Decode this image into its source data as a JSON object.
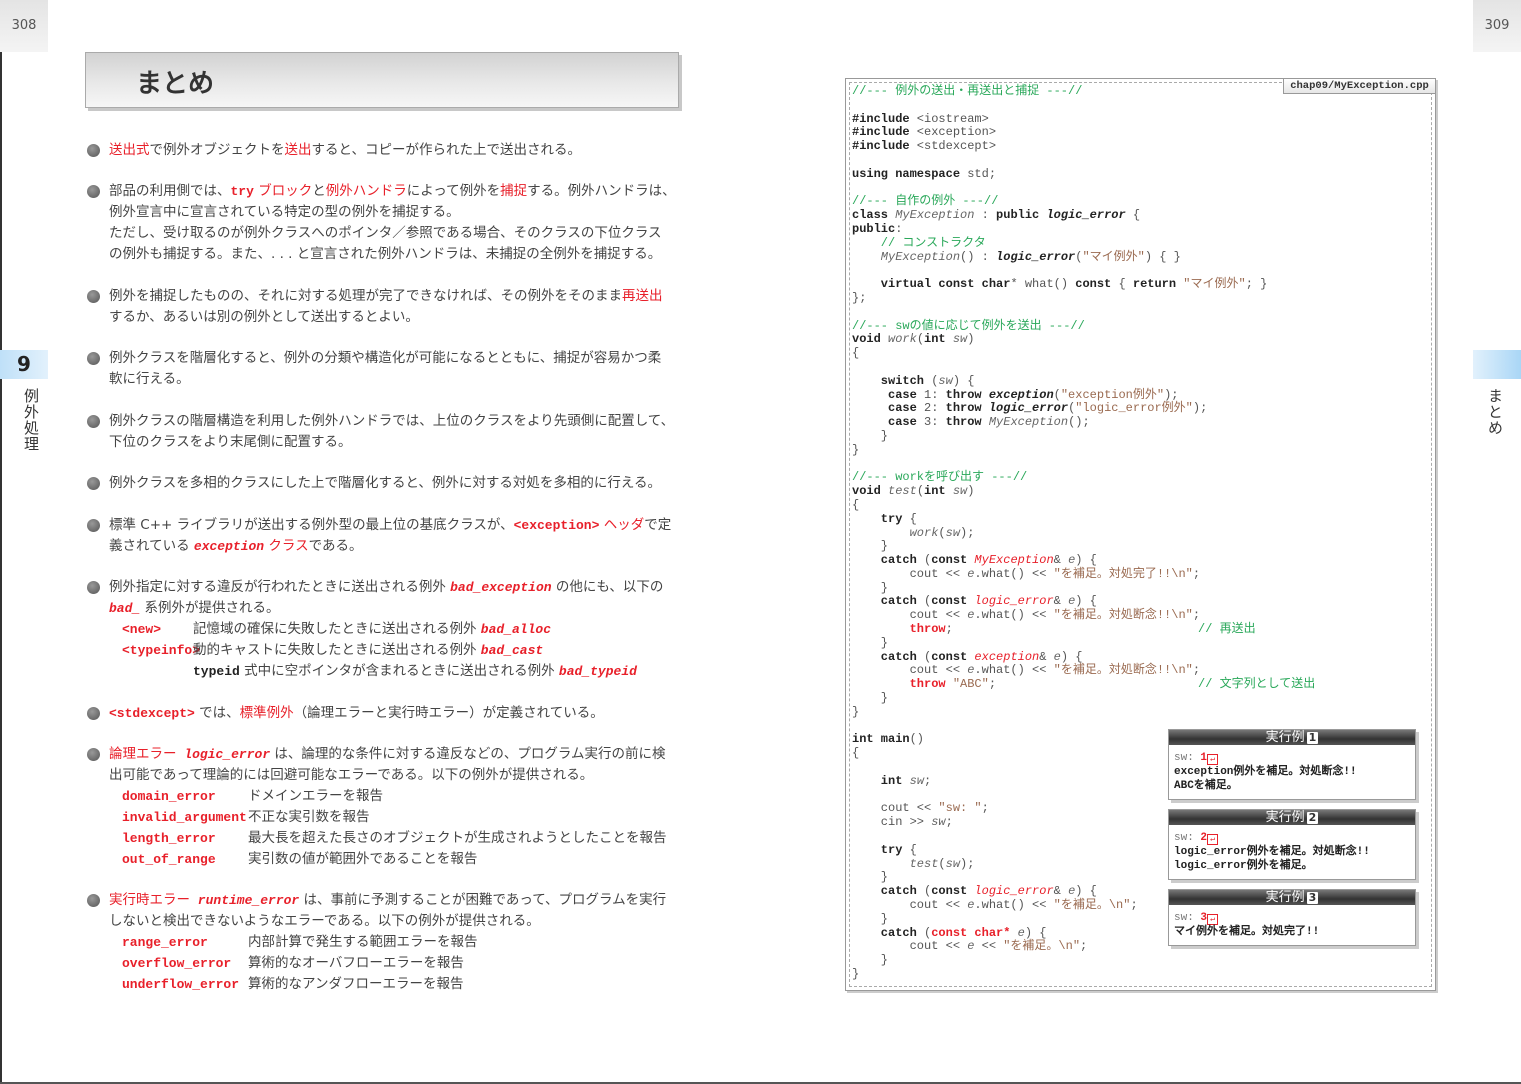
{
  "pages": {
    "left_number": "308",
    "right_number": "309"
  },
  "tabs": {
    "chapter_number": "9",
    "chapter_title": "例外処理",
    "section_title": "まとめ"
  },
  "left": {
    "title": "まとめ",
    "bullets": [
      {
        "lines": [
          [
            [
              "送出式",
              "r"
            ],
            [
              "で例外オブジェクトを",
              ""
            ],
            [
              "送出",
              "r"
            ],
            [
              "すると、コピーが作られた上で送出される。",
              ""
            ]
          ]
        ]
      },
      {
        "lines": [
          [
            [
              "部品の利用側では、",
              ""
            ],
            [
              "try",
              "rc"
            ],
            [
              " ブロック",
              "r"
            ],
            [
              "と",
              ""
            ],
            [
              "例外ハンドラ",
              "r"
            ],
            [
              "によって例外を",
              ""
            ],
            [
              "捕捉",
              "r"
            ],
            [
              "する。例外ハンドラは、",
              ""
            ]
          ],
          [
            [
              "例外宣言中に宣言されている特定の型の例外を捕捉する。",
              ""
            ]
          ],
          [
            [
              "ただし、受け取るのが例外クラスへのポインタ／参照である場合、そのクラスの下位クラス",
              ""
            ]
          ],
          [
            [
              "の例外も捕捉する。また、. . . と宣言された例外ハンドラは、未捕捉の全例外を捕捉する。",
              ""
            ]
          ]
        ]
      },
      {
        "lines": [
          [
            [
              "例外を捕捉したものの、それに対する処理が完了できなければ、その例外をそのまま",
              ""
            ],
            [
              "再送出",
              "r"
            ]
          ],
          [
            [
              "するか、あるいは別の例外として送出するとよい。",
              ""
            ]
          ]
        ]
      },
      {
        "lines": [
          [
            [
              "例外クラスを階層化すると、例外の分類や構造化が可能になるとともに、捕捉が容易かつ柔",
              ""
            ]
          ],
          [
            [
              "軟に行える。",
              ""
            ]
          ]
        ]
      },
      {
        "lines": [
          [
            [
              "例外クラスの階層構造を利用した例外ハンドラでは、上位のクラスをより先頭側に配置して、",
              ""
            ]
          ],
          [
            [
              "下位のクラスをより末尾側に配置する。",
              ""
            ]
          ]
        ]
      },
      {
        "lines": [
          [
            [
              "例外クラスを多相的クラスにした上で階層化すると、例外に対する対処を多相的に行える。",
              ""
            ]
          ]
        ]
      },
      {
        "lines": [
          [
            [
              "標準 C++ ライブラリが送出する例外型の最上位の基底クラスが、",
              ""
            ],
            [
              "<exception>",
              "rc"
            ],
            [
              " ヘッダ",
              "r"
            ],
            [
              "で定",
              ""
            ]
          ],
          [
            [
              "義されている ",
              ""
            ],
            [
              "exception",
              "ri"
            ],
            [
              " クラス",
              "r"
            ],
            [
              "である。",
              ""
            ]
          ]
        ]
      },
      {
        "lines": [
          [
            [
              "例外指定に対する違反が行われたときに送出される例外 ",
              ""
            ],
            [
              "bad_exception",
              "ri"
            ],
            [
              " の他にも、以下の",
              ""
            ]
          ],
          [
            [
              "bad_",
              "ri"
            ],
            [
              " 系例外が提供される。",
              ""
            ]
          ]
        ],
        "sub": [
          {
            "label": "<new>",
            "desc": [
              [
                "記憶域の確保に失敗したときに送出される例外 ",
                ""
              ],
              [
                "bad_alloc",
                "ri"
              ]
            ]
          },
          {
            "label": "<typeinfo>",
            "desc": [
              [
                "動的キャストに失敗したときに送出される例外 ",
                ""
              ],
              [
                "bad_cast",
                "ri"
              ]
            ]
          },
          {
            "label": "",
            "desc": [
              [
                "typeid",
                "c"
              ],
              [
                " 式中に空ポインタが含まれるときに送出される例外 ",
                ""
              ],
              [
                "bad_typeid",
                "ri"
              ]
            ]
          }
        ]
      },
      {
        "lines": [
          [
            [
              "<stdexcept>",
              "rc"
            ],
            [
              " では、",
              ""
            ],
            [
              "標準例外",
              "r"
            ],
            [
              "（論理エラーと実行時エラー）が定義されている。",
              ""
            ]
          ]
        ]
      },
      {
        "lines": [
          [
            [
              "論理エラー",
              "r"
            ],
            [
              " logic_error",
              "ri"
            ],
            [
              " は、論理的な条件に対する違反などの、プログラム実行の前に検",
              ""
            ]
          ],
          [
            [
              "出可能であって理論的には回避可能なエラーである。以下の例外が提供される。",
              ""
            ]
          ]
        ],
        "sub": [
          {
            "label": "domain_error",
            "desc": [
              [
                "ドメインエラーを報告",
                ""
              ]
            ]
          },
          {
            "label": "invalid_argument",
            "desc": [
              [
                "不正な実引数を報告",
                ""
              ]
            ]
          },
          {
            "label": "length_error",
            "desc": [
              [
                "最大長を超えた長さのオブジェクトが生成されようとしたことを報告",
                ""
              ]
            ]
          },
          {
            "label": "out_of_range",
            "desc": [
              [
                "実引数の値が範囲外であることを報告",
                ""
              ]
            ]
          }
        ]
      },
      {
        "lines": [
          [
            [
              "実行時エラー",
              "r"
            ],
            [
              " runtime_error",
              "ri"
            ],
            [
              " は、事前に予測することが困難であって、プログラムを実行",
              ""
            ]
          ],
          [
            [
              "しないと検出できないようなエラーである。以下の例外が提供される。",
              ""
            ]
          ]
        ],
        "sub": [
          {
            "label": "range_error",
            "desc": [
              [
                "内部計算で発生する範囲エラーを報告",
                ""
              ]
            ]
          },
          {
            "label": "overflow_error",
            "desc": [
              [
                "算術的なオーバフローエラーを報告",
                ""
              ]
            ]
          },
          {
            "label": "underflow_error",
            "desc": [
              [
                "算術的なアンダフローエラーを報告",
                ""
              ]
            ]
          }
        ]
      }
    ]
  },
  "code": {
    "filename": "chap09/MyException.cpp",
    "lines": [
      [
        [
          "//--- 例外の送出・再送出と捕捉 ---//",
          "g"
        ]
      ],
      [],
      [
        [
          "#include",
          "k"
        ],
        [
          " <iostream>",
          "n"
        ]
      ],
      [
        [
          "#include",
          "k"
        ],
        [
          " <exception>",
          "n"
        ]
      ],
      [
        [
          "#include",
          "k"
        ],
        [
          " <stdexcept>",
          "n"
        ]
      ],
      [],
      [
        [
          "using namespace",
          "k"
        ],
        [
          " std;",
          "n"
        ]
      ],
      [],
      [
        [
          "//--- 自作の例外 ---//",
          "g"
        ]
      ],
      [
        [
          "class",
          "k"
        ],
        [
          " MyException",
          "i"
        ],
        [
          " : ",
          "n"
        ],
        [
          "public",
          "k"
        ],
        [
          " logic_error",
          "ki"
        ],
        [
          " {",
          "n"
        ]
      ],
      [
        [
          "public",
          "k"
        ],
        [
          ":",
          "n"
        ]
      ],
      [
        [
          "    // コンストラクタ",
          "g"
        ]
      ],
      [
        [
          "    MyException",
          "i"
        ],
        [
          "() : ",
          "n"
        ],
        [
          "logic_error",
          "ki"
        ],
        [
          "(",
          "n"
        ],
        [
          "\"マイ例外\"",
          "s"
        ],
        [
          ") { }",
          "n"
        ]
      ],
      [],
      [
        [
          "    virtual const char",
          "k"
        ],
        [
          "* what() ",
          "n"
        ],
        [
          "const",
          "k"
        ],
        [
          " { ",
          "n"
        ],
        [
          "return",
          "k"
        ],
        [
          " ",
          "n"
        ],
        [
          "\"マイ例外\"",
          "s"
        ],
        [
          "; }",
          "n"
        ]
      ],
      [
        [
          "};",
          "n"
        ]
      ],
      [],
      [
        [
          "//--- swの値に応じて例外を送出 ---//",
          "g"
        ]
      ],
      [
        [
          "void",
          "k"
        ],
        [
          " work",
          "i"
        ],
        [
          "(",
          "n"
        ],
        [
          "int",
          "k"
        ],
        [
          " sw",
          "i"
        ],
        [
          ")",
          "n"
        ]
      ],
      [
        [
          "{",
          "n"
        ]
      ],
      [],
      [
        [
          "    switch",
          "k"
        ],
        [
          " (",
          "n"
        ],
        [
          "sw",
          "i"
        ],
        [
          ") {",
          "n"
        ]
      ],
      [
        [
          "     case",
          "k"
        ],
        [
          " 1: ",
          "n"
        ],
        [
          "throw",
          "k"
        ],
        [
          " exception",
          "ki"
        ],
        [
          "(",
          "n"
        ],
        [
          "\"exception例外\"",
          "s"
        ],
        [
          ");",
          "n"
        ]
      ],
      [
        [
          "     case",
          "k"
        ],
        [
          " 2: ",
          "n"
        ],
        [
          "throw",
          "k"
        ],
        [
          " logic_error",
          "ki"
        ],
        [
          "(",
          "n"
        ],
        [
          "\"logic_error例外\"",
          "s"
        ],
        [
          ");",
          "n"
        ]
      ],
      [
        [
          "     case",
          "k"
        ],
        [
          " 3: ",
          "n"
        ],
        [
          "throw",
          "k"
        ],
        [
          " MyException",
          "i"
        ],
        [
          "();",
          "n"
        ]
      ],
      [
        [
          "    }",
          "n"
        ]
      ],
      [
        [
          "}",
          "n"
        ]
      ],
      [],
      [
        [
          "//--- workを呼び出す ---//",
          "g"
        ]
      ],
      [
        [
          "void",
          "k"
        ],
        [
          " test",
          "i"
        ],
        [
          "(",
          "n"
        ],
        [
          "int",
          "k"
        ],
        [
          " sw",
          "i"
        ],
        [
          ")",
          "n"
        ]
      ],
      [
        [
          "{",
          "n"
        ]
      ],
      [
        [
          "    try",
          "k"
        ],
        [
          " {",
          "n"
        ]
      ],
      [
        [
          "        work",
          "i"
        ],
        [
          "(",
          "n"
        ],
        [
          "sw",
          "i"
        ],
        [
          ");",
          "n"
        ]
      ],
      [
        [
          "    }",
          "n"
        ]
      ],
      [
        [
          "    catch",
          "k"
        ],
        [
          " (",
          "n"
        ],
        [
          "const",
          "k"
        ],
        [
          " MyException",
          "ir"
        ],
        [
          "& ",
          "n"
        ],
        [
          "e",
          "i"
        ],
        [
          ") {",
          "n"
        ]
      ],
      [
        [
          "        cout << ",
          "n"
        ],
        [
          "e",
          "i"
        ],
        [
          ".what() << ",
          "n"
        ],
        [
          "\"を補足。対処完了!!\\n\"",
          "s"
        ],
        [
          ";",
          "n"
        ]
      ],
      [
        [
          "    }",
          "n"
        ]
      ],
      [
        [
          "    catch",
          "k"
        ],
        [
          " (",
          "n"
        ],
        [
          "const",
          "k"
        ],
        [
          " logic_error",
          "ir"
        ],
        [
          "& ",
          "n"
        ],
        [
          "e",
          "i"
        ],
        [
          ") {",
          "n"
        ]
      ],
      [
        [
          "        cout << ",
          "n"
        ],
        [
          "e",
          "i"
        ],
        [
          ".what() << ",
          "n"
        ],
        [
          "\"を補足。対処断念!!\\n\"",
          "s"
        ],
        [
          ";",
          "n"
        ]
      ],
      [
        [
          "        throw",
          "kr"
        ],
        [
          ";",
          "n"
        ],
        [
          "// 再送出",
          "ga"
        ]
      ],
      [
        [
          "    }",
          "n"
        ]
      ],
      [
        [
          "    catch",
          "k"
        ],
        [
          " (",
          "n"
        ],
        [
          "const",
          "k"
        ],
        [
          " exception",
          "ir"
        ],
        [
          "& ",
          "n"
        ],
        [
          "e",
          "i"
        ],
        [
          ") {",
          "n"
        ]
      ],
      [
        [
          "        cout << ",
          "n"
        ],
        [
          "e",
          "i"
        ],
        [
          ".what() << ",
          "n"
        ],
        [
          "\"を補足。対処断念!!\\n\"",
          "s"
        ],
        [
          ";",
          "n"
        ]
      ],
      [
        [
          "        throw",
          "kr"
        ],
        [
          " ",
          "n"
        ],
        [
          "\"ABC\"",
          "s"
        ],
        [
          ";",
          "n"
        ],
        [
          "// 文字列として送出",
          "ga"
        ]
      ],
      [
        [
          "    }",
          "n"
        ]
      ],
      [
        [
          "}",
          "n"
        ]
      ],
      [],
      [
        [
          "int main",
          "k"
        ],
        [
          "()",
          "n"
        ]
      ],
      [
        [
          "{",
          "n"
        ]
      ],
      [],
      [
        [
          "    int",
          "k"
        ],
        [
          " sw",
          "i"
        ],
        [
          ";",
          "n"
        ]
      ],
      [],
      [
        [
          "    cout << ",
          "n"
        ],
        [
          "\"sw: \"",
          "s"
        ],
        [
          ";",
          "n"
        ]
      ],
      [
        [
          "    cin >> ",
          "n"
        ],
        [
          "sw",
          "i"
        ],
        [
          ";",
          "n"
        ]
      ],
      [],
      [
        [
          "    try",
          "k"
        ],
        [
          " {",
          "n"
        ]
      ],
      [
        [
          "        test",
          "i"
        ],
        [
          "(",
          "n"
        ],
        [
          "sw",
          "i"
        ],
        [
          ");",
          "n"
        ]
      ],
      [
        [
          "    }",
          "n"
        ]
      ],
      [
        [
          "    catch",
          "k"
        ],
        [
          " (",
          "n"
        ],
        [
          "const",
          "k"
        ],
        [
          " logic_error",
          "ir"
        ],
        [
          "& ",
          "n"
        ],
        [
          "e",
          "i"
        ],
        [
          ") {",
          "n"
        ]
      ],
      [
        [
          "        cout << ",
          "n"
        ],
        [
          "e",
          "i"
        ],
        [
          ".what() << ",
          "n"
        ],
        [
          "\"を補足。\\n\"",
          "s"
        ],
        [
          ";",
          "n"
        ]
      ],
      [
        [
          "    }",
          "n"
        ]
      ],
      [
        [
          "    catch",
          "k"
        ],
        [
          " (",
          "n"
        ],
        [
          "const char",
          "kr"
        ],
        [
          "* ",
          "kr"
        ],
        [
          "e",
          "i"
        ],
        [
          ") {",
          "n"
        ]
      ],
      [
        [
          "        cout << ",
          "n"
        ],
        [
          "e",
          "i"
        ],
        [
          " << ",
          "n"
        ],
        [
          "\"を補足。\\n\"",
          "s"
        ],
        [
          ";",
          "n"
        ]
      ],
      [
        [
          "    }",
          "n"
        ]
      ],
      [
        [
          "}",
          "n"
        ]
      ]
    ]
  },
  "runs": [
    {
      "title": "実行例",
      "number": "1",
      "prompt": "sw: ",
      "input": "1",
      "enter_icon": "return-key-icon",
      "output": [
        "exception例外を補足。対処断念!!",
        "ABCを補足。"
      ]
    },
    {
      "title": "実行例",
      "number": "2",
      "prompt": "sw: ",
      "input": "2",
      "enter_icon": "return-key-icon",
      "output": [
        "logic_error例外を補足。対処断念!!",
        "logic_error例外を補足。"
      ]
    },
    {
      "title": "実行例",
      "number": "3",
      "prompt": "sw: ",
      "input": "3",
      "enter_icon": "return-key-icon",
      "output": [
        "マイ例外を補足。対処完了!!"
      ]
    }
  ],
  "colors": {
    "accent_red": "#e8202a",
    "comment_green": "#2aa85a",
    "string_brown": "#9a6a50",
    "tab_blue": "#bfe0f8"
  }
}
